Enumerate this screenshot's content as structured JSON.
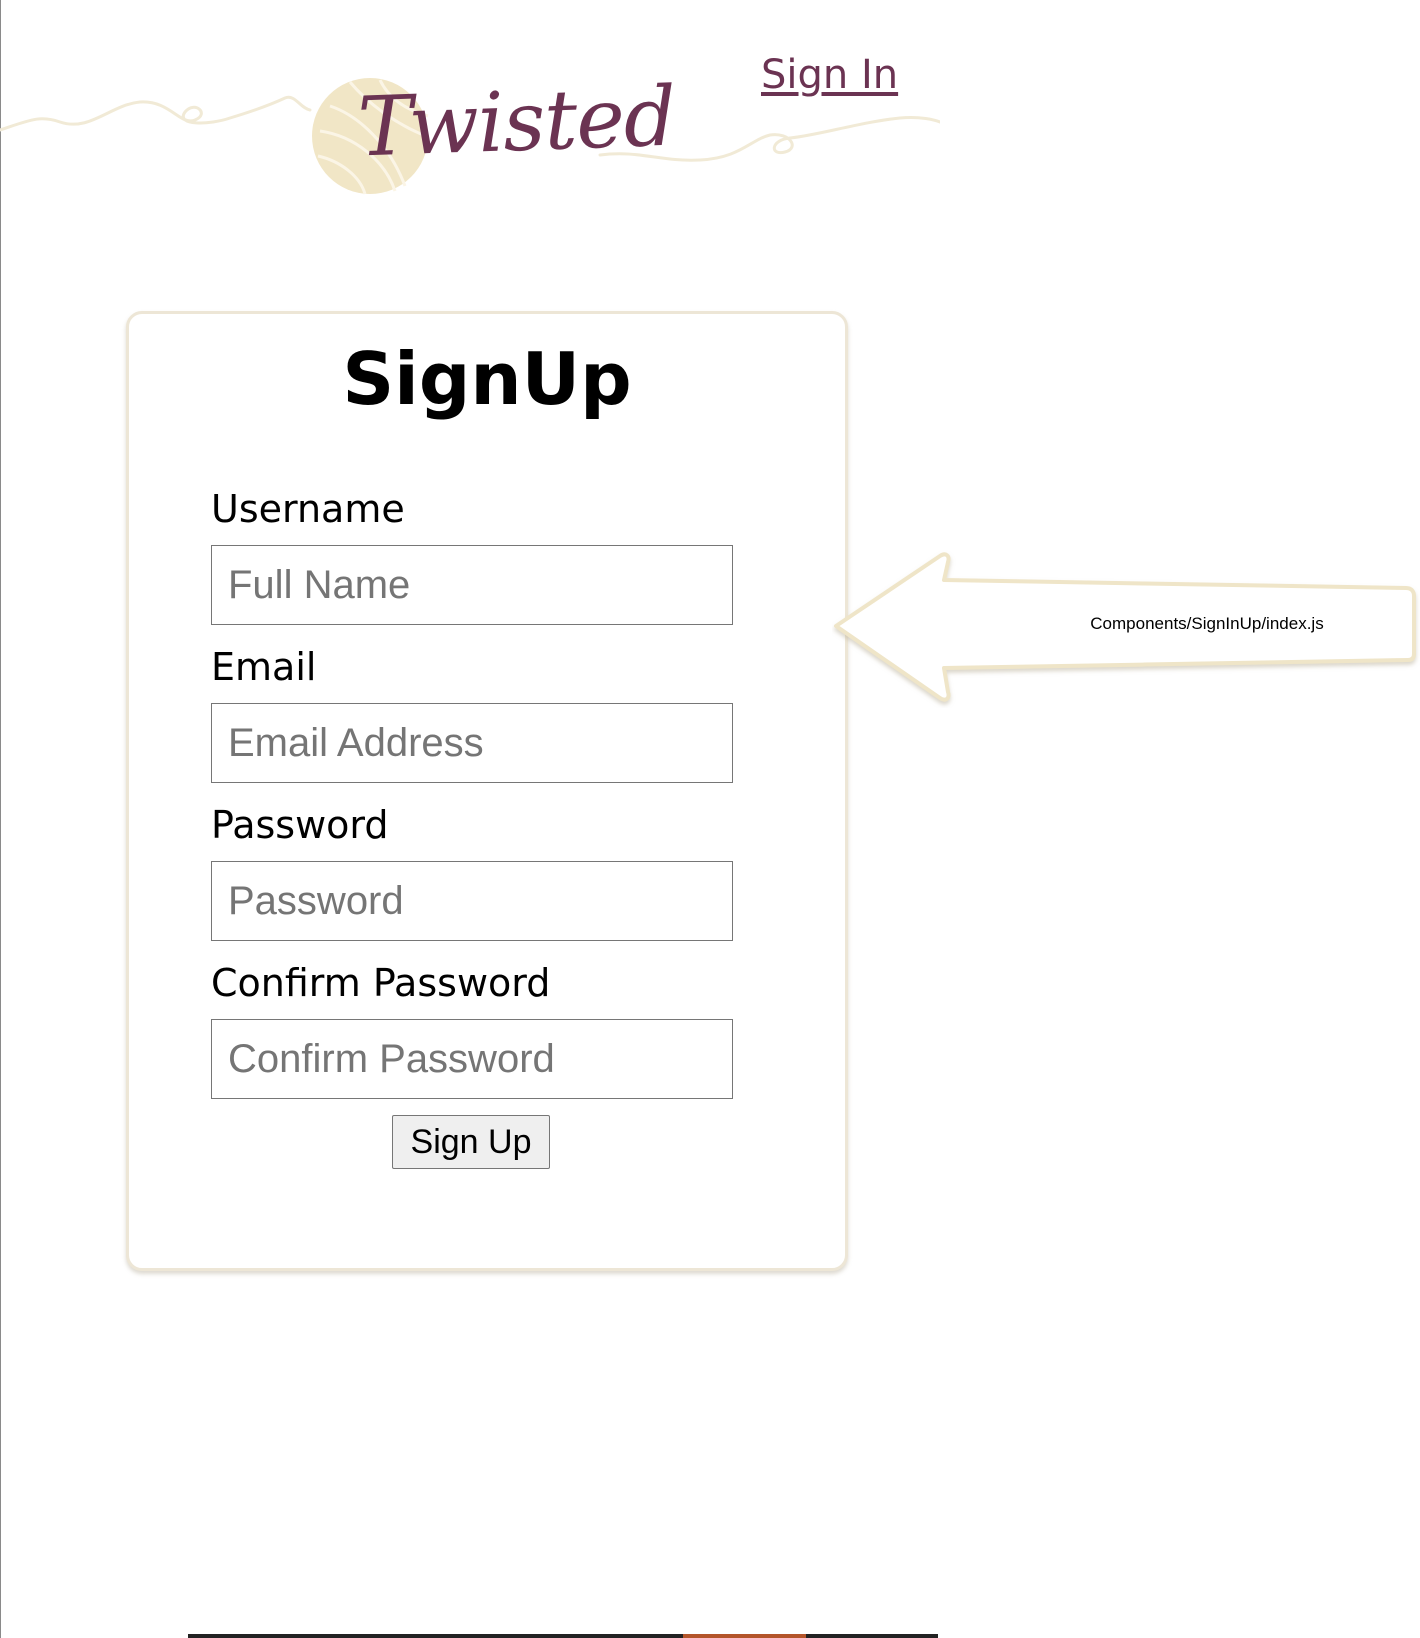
{
  "brand": {
    "logo_text": "Twisted",
    "accent_color": "#6b3352",
    "cream_color": "#efe5c8"
  },
  "nav": {
    "sign_in_label": "Sign In"
  },
  "form": {
    "title": "SignUp",
    "fields": [
      {
        "label": "Username",
        "placeholder": "Full Name",
        "value": ""
      },
      {
        "label": "Email",
        "placeholder": "Email Address",
        "value": ""
      },
      {
        "label": "Password",
        "placeholder": "Password",
        "value": ""
      },
      {
        "label": "Confirm Password",
        "placeholder": "Confirm Password",
        "value": ""
      }
    ],
    "submit_label": "Sign Up"
  },
  "annotation": {
    "text": "Components/SignInUp/index.js",
    "icon": "arrow-left-callout-icon"
  }
}
